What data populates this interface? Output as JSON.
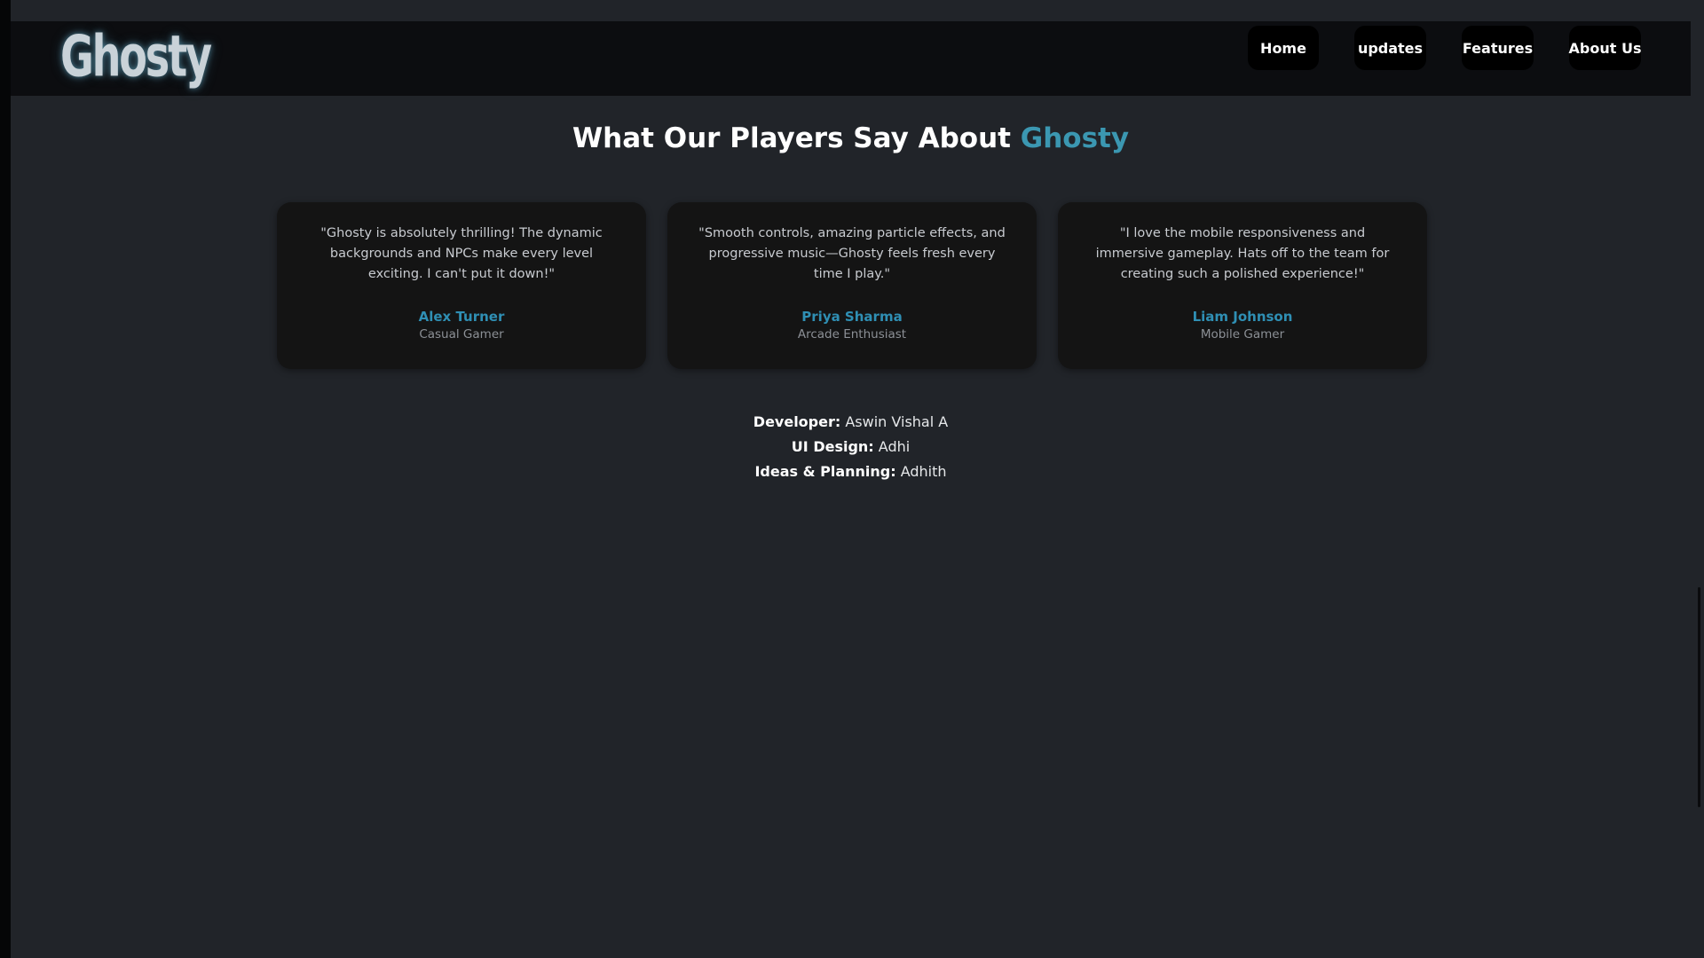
{
  "header": {
    "logo_text": "Ghosty",
    "nav": [
      {
        "label": "Home"
      },
      {
        "label": "updates"
      },
      {
        "label": "Features"
      },
      {
        "label": "About Us"
      }
    ]
  },
  "testimonials": {
    "title_prefix": "What Our Players Say About ",
    "title_accent": "Ghosty",
    "items": [
      {
        "quote": "\"Ghosty is absolutely thrilling! The dynamic backgrounds and NPCs make every level exciting. I can't put it down!\"",
        "name": "Alex Turner",
        "role": "Casual Gamer"
      },
      {
        "quote": "\"Smooth controls, amazing particle effects, and progressive music—Ghosty feels fresh every time I play.\"",
        "name": "Priya Sharma",
        "role": "Arcade Enthusiast"
      },
      {
        "quote": "\"I love the mobile responsiveness and immersive gameplay. Hats off to the team for creating such a polished experience!\"",
        "name": "Liam Johnson",
        "role": "Mobile Gamer"
      }
    ]
  },
  "credits": [
    {
      "label": "Developer:",
      "value": "Aswin Vishal A"
    },
    {
      "label": "UI Design:",
      "value": "Adhi"
    },
    {
      "label": "Ideas & Planning:",
      "value": "Adhith"
    }
  ],
  "colors": {
    "accent": "#3b97b1",
    "name_accent": "#2f8fb4",
    "page_bg": "#212429",
    "card_bg": "#141414",
    "nav_bg": "#0c0d10"
  }
}
